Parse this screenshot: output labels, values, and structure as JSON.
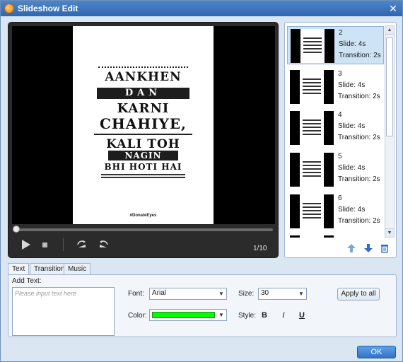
{
  "window": {
    "title": "Slideshow Edit",
    "close_glyph": "✕"
  },
  "player": {
    "poster": {
      "lines": [
        "AANKHEN",
        "DAN",
        "KARNI",
        "CHAHIYE,",
        "KALI TOH",
        "NAGIN",
        "BHI HOTI HAI"
      ],
      "hashtag": "#DonateEyes"
    },
    "counter": "1/10",
    "controls": [
      "play-icon",
      "stop-icon",
      "rotate-left-icon",
      "rotate-right-icon"
    ]
  },
  "slides": [
    {
      "number": "2",
      "slide": "Slide: 4s",
      "transition": "Transition: 2s",
      "selected": true
    },
    {
      "number": "3",
      "slide": "Slide: 4s",
      "transition": "Transition: 2s",
      "selected": false
    },
    {
      "number": "4",
      "slide": "Slide: 4s",
      "transition": "Transition: 2s",
      "selected": false
    },
    {
      "number": "5",
      "slide": "Slide: 4s",
      "transition": "Transition: 2s",
      "selected": false
    },
    {
      "number": "6",
      "slide": "Slide: 4s",
      "transition": "Transition: 2s",
      "selected": false
    }
  ],
  "slide_panel": {
    "buttons": [
      "arrow-up-icon",
      "arrow-down-icon",
      "trash-icon"
    ]
  },
  "tabs": [
    {
      "label": "Text",
      "active": true
    },
    {
      "label": "Transition",
      "active": false
    },
    {
      "label": "Music",
      "active": false
    }
  ],
  "text_tab": {
    "add_text_label": "Add Text:",
    "text_placeholder": "Please input text here",
    "font_label": "Font:",
    "font_value": "Arial",
    "size_label": "Size:",
    "size_value": "30",
    "color_label": "Color:",
    "color_value": "#00ff00",
    "style_label": "Style:",
    "bold": "B",
    "italic": "I",
    "underline": "U",
    "apply_label": "Apply to all"
  },
  "ok_label": "OK",
  "colors": {
    "accent": "#2f72c7",
    "titlebar": "#3a72bd",
    "player_bg": "#2b2b2b"
  }
}
